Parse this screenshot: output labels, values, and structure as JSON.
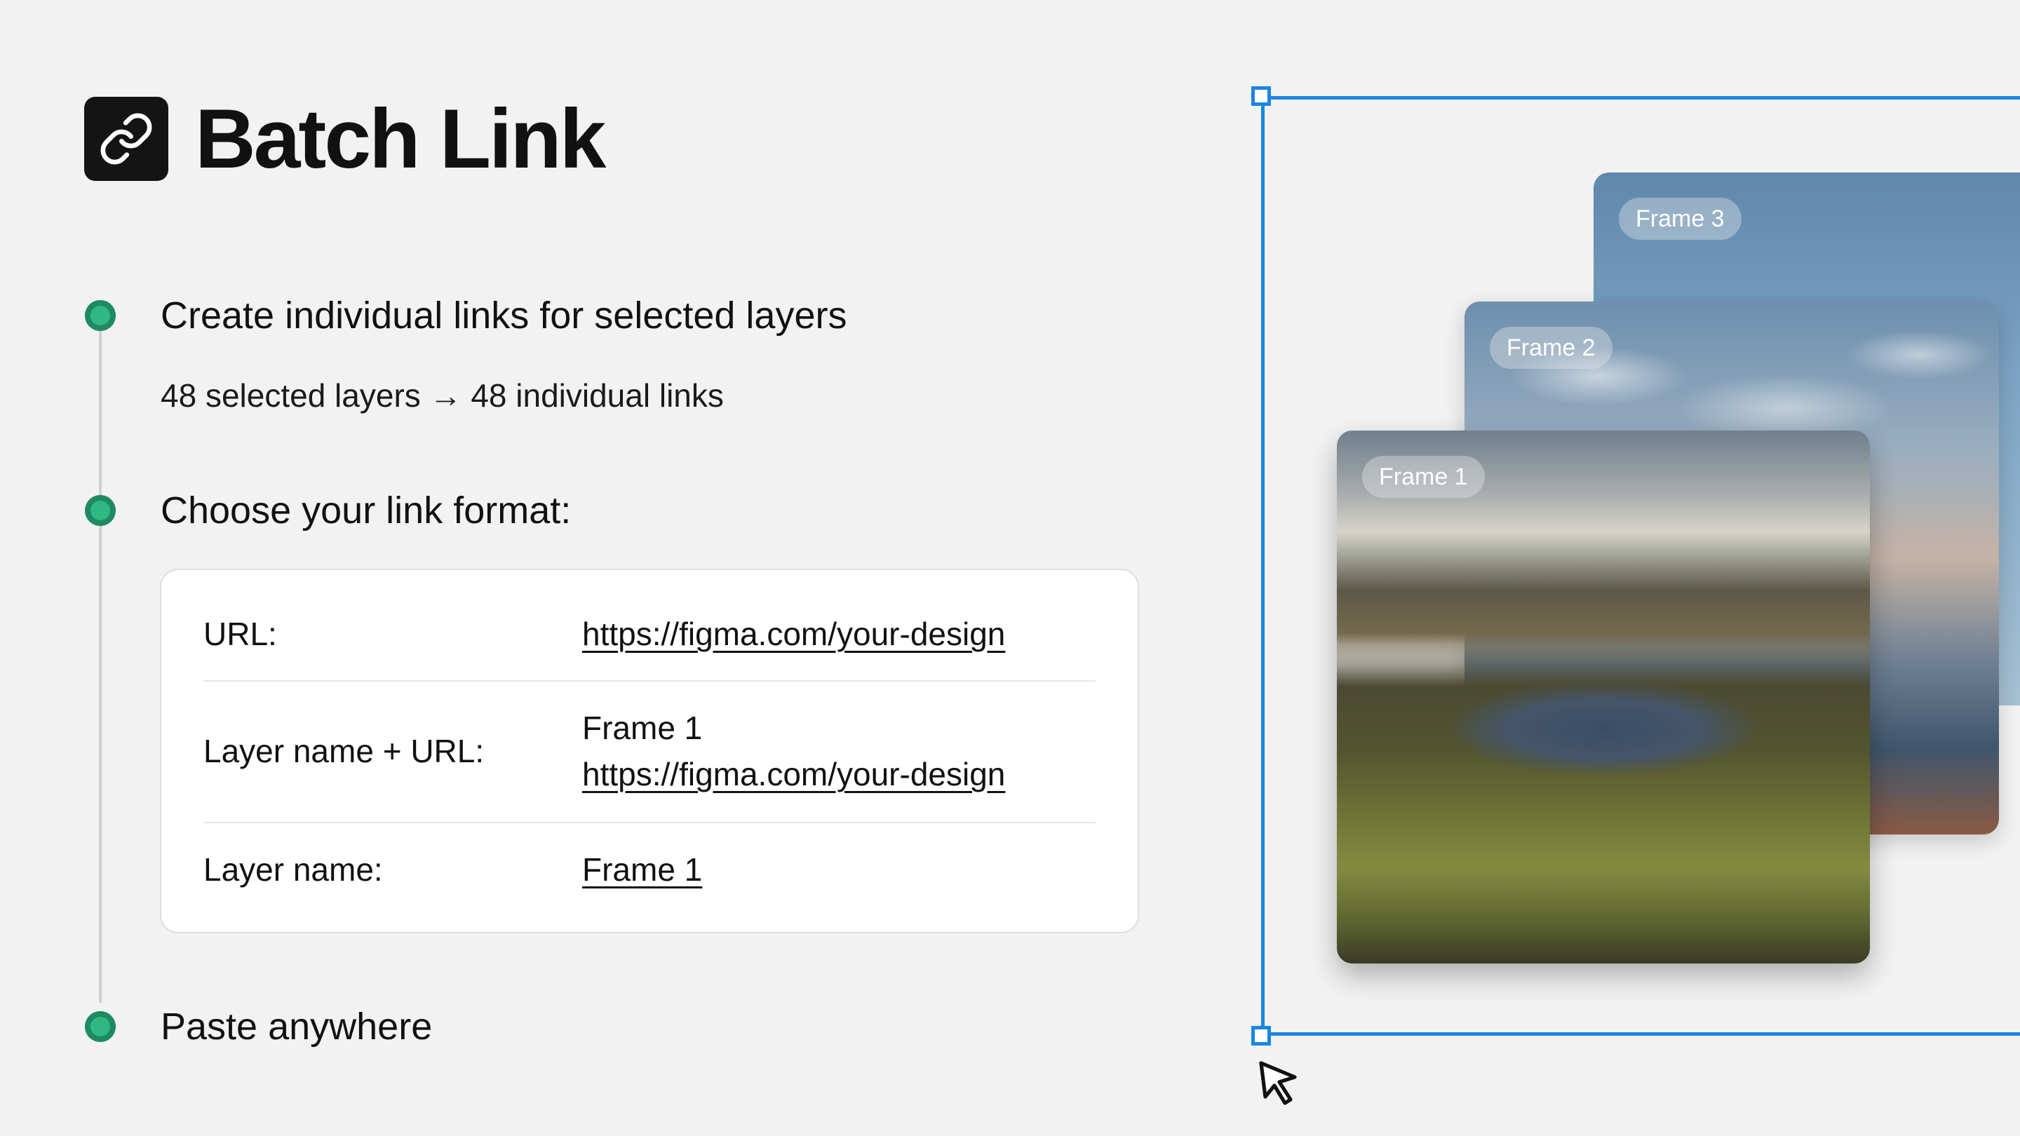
{
  "header": {
    "title": "Batch Link",
    "logo_icon": "link-icon"
  },
  "steps": [
    {
      "heading": "Create individual links for selected layers",
      "sub": "48 selected layers → 48 individual links"
    },
    {
      "heading": "Choose your link format:"
    },
    {
      "heading": "Paste anywhere"
    }
  ],
  "formats": [
    {
      "label": "URL:",
      "value": "https://figma.com/your-design"
    },
    {
      "label": "Layer name + URL:",
      "name": "Frame 1",
      "value": "https://figma.com/your-design"
    },
    {
      "label": "Layer name:",
      "value": "Frame 1"
    }
  ],
  "frames": [
    {
      "label": "Frame 3"
    },
    {
      "label": "Frame 2"
    },
    {
      "label": "Frame 1"
    }
  ],
  "colors": {
    "background": "#f2f2f2",
    "step_dot": "#2fb884",
    "selection": "#1b86e0"
  }
}
